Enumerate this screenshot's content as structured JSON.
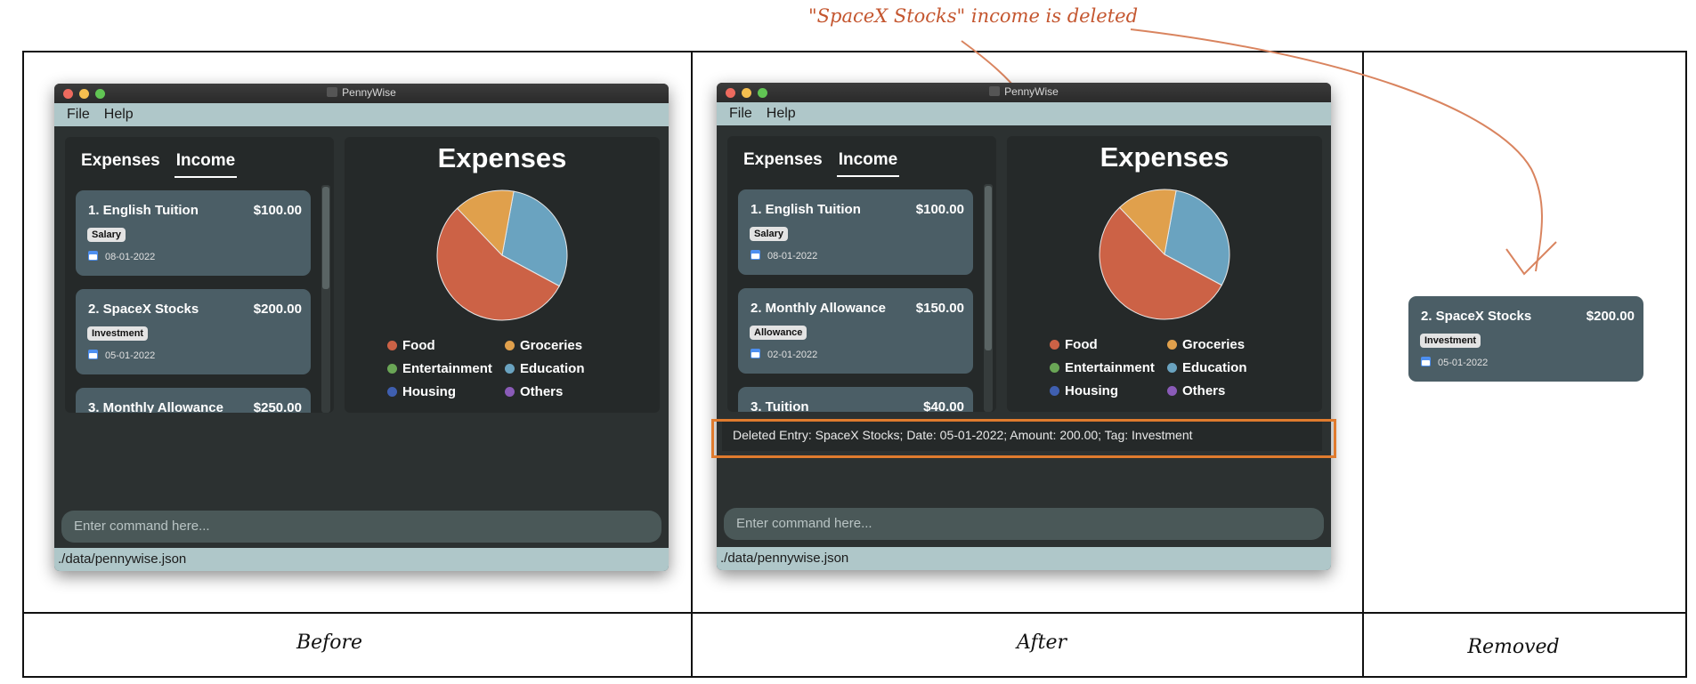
{
  "annotation": "\"SpaceX Stocks\" income is deleted",
  "captions": {
    "before": "Before",
    "after": "After",
    "removed": "Removed"
  },
  "colors": {
    "highlight_box": "#e07b2e",
    "annotation": "#c4562f"
  },
  "window": {
    "title": "PennyWise",
    "menu": [
      "File",
      "Help"
    ],
    "footer_path": "./data/pennywise.json",
    "command_placeholder": "Enter command here..."
  },
  "tabs": [
    "Expenses",
    "Income"
  ],
  "active_tab": "Income",
  "before": {
    "entries": [
      {
        "index_name": "1.  English Tuition",
        "amount": "$100.00",
        "tag": "Salary",
        "date": "08-01-2022"
      },
      {
        "index_name": "2.  SpaceX Stocks",
        "amount": "$200.00",
        "tag": "Investment",
        "date": "05-01-2022"
      },
      {
        "index_name": "3.  Monthly Allowance",
        "amount": "$250.00",
        "tag": "",
        "date": ""
      }
    ]
  },
  "after": {
    "entries": [
      {
        "index_name": "1.  English Tuition",
        "amount": "$100.00",
        "tag": "Salary",
        "date": "08-01-2022"
      },
      {
        "index_name": "2.  Monthly Allowance",
        "amount": "$150.00",
        "tag": "Allowance",
        "date": "02-01-2022"
      },
      {
        "index_name": "3.  Tuition",
        "amount": "$40.00",
        "tag": "",
        "date": ""
      }
    ],
    "result_message": "Deleted Entry: SpaceX Stocks; Date: 05-01-2022; Amount: 200.00; Tag: Investment"
  },
  "removed": {
    "index_name": "2.  SpaceX Stocks",
    "amount": "$200.00",
    "tag": "Investment",
    "date": "05-01-2022"
  },
  "chart_data": {
    "type": "pie",
    "title": "Expenses",
    "categories": [
      "Food",
      "Groceries",
      "Entertainment",
      "Education",
      "Housing",
      "Others"
    ],
    "values": [
      55,
      15,
      0,
      30,
      0,
      0
    ],
    "colors": [
      "#cc6246",
      "#e0a04c",
      "#6aa656",
      "#6aa3c0",
      "#3f5fb0",
      "#8a5bb8"
    ],
    "legend": [
      "Food",
      "Groceries",
      "Entertainment",
      "Education",
      "Housing",
      "Others"
    ]
  }
}
